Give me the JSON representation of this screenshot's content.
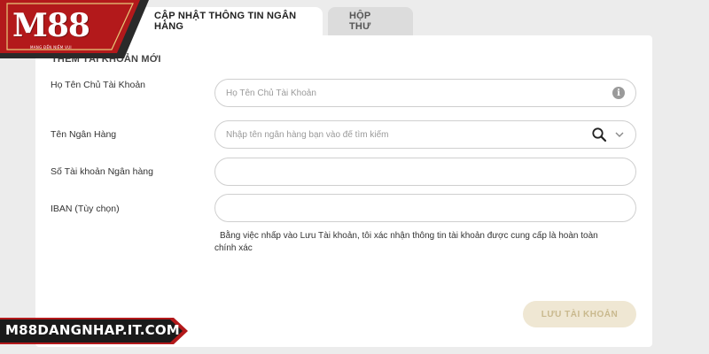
{
  "tabs": [
    {
      "label": "CẬP NHẬT THÔNG TIN NGÂN HÀNG",
      "active": true
    },
    {
      "label": "HỘP THƯ",
      "active": false
    }
  ],
  "form": {
    "section_title": "THÊM TÀI KHOẢN MỚI",
    "fields": [
      {
        "label": "Họ Tên Chủ Tài Khoản",
        "placeholder": "Họ Tên Chủ Tài Khoản",
        "value": "",
        "icon": "info-icon"
      },
      {
        "label": "Tên Ngân Hàng",
        "placeholder": "Nhập tên ngân hàng bạn vào để tìm kiếm",
        "value": "",
        "icon": "search-icon"
      },
      {
        "label": "Số Tài khoản Ngân hàng",
        "placeholder": "",
        "value": ""
      },
      {
        "label": "IBAN (Tùy chọn)",
        "placeholder": "",
        "value": ""
      }
    ],
    "note_line1": "Bằng việc nhấp vào Lưu Tài khoản, tôi xác nhận thông tin tài khoản được cung cấp là hoàn toàn",
    "note_line2": "chính xác",
    "save_label": "LƯU TÀI KHOẢN"
  },
  "logo": {
    "text": "M88",
    "tagline": "MANG ĐẾN NIỀM VUI"
  },
  "watermark": {
    "text": "M88DANGNHAP.IT.COM"
  },
  "colors": {
    "brand_red": "#b3191b",
    "brand_dark": "#2a2a2a",
    "save_button_bg": "#efe7d3",
    "save_button_text": "#c9b98e"
  }
}
